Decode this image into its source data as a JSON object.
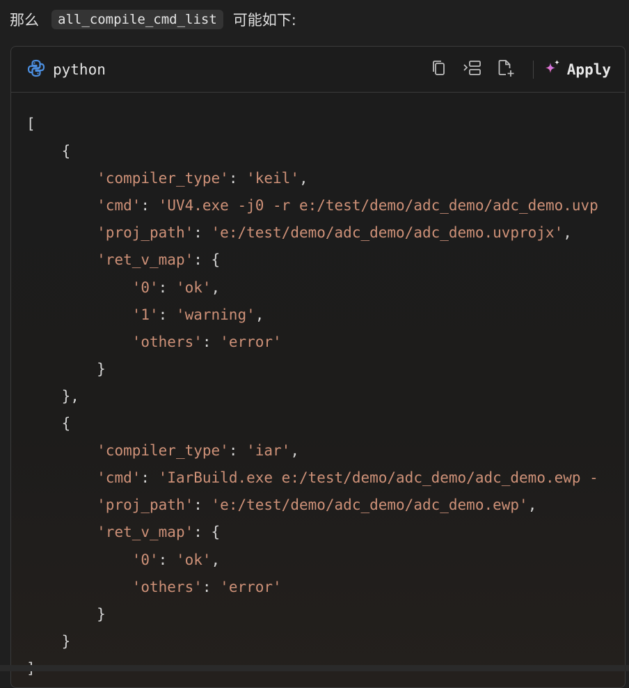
{
  "intro": {
    "prefix": "那么",
    "inline_code": "all_compile_cmd_list",
    "suffix": "可能如下:"
  },
  "code_block": {
    "language": "python",
    "apply_label": "Apply",
    "icons": {
      "language": "python-logo-icon",
      "copy": "copy-icon",
      "insert": "insert-at-cursor-icon",
      "new_file": "new-file-icon",
      "apply": "sparkle-icon"
    },
    "lines": [
      "[",
      "    {",
      "        'compiler_type': 'keil',",
      "        'cmd': 'UV4.exe -j0 -r e:/test/demo/adc_demo/adc_demo.uvp",
      "        'proj_path': 'e:/test/demo/adc_demo/adc_demo.uvprojx',",
      "        'ret_v_map': {",
      "            '0': 'ok',",
      "            '1': 'warning',",
      "            'others': 'error'",
      "        }",
      "    },",
      "    {",
      "        'compiler_type': 'iar',",
      "        'cmd': 'IarBuild.exe e:/test/demo/adc_demo/adc_demo.ewp -",
      "        'proj_path': 'e:/test/demo/adc_demo/adc_demo.ewp',",
      "        'ret_v_map': {",
      "            '0': 'ok',",
      "            'others': 'error'",
      "        }",
      "    }",
      "]"
    ]
  },
  "colors": {
    "string": "#ce9178",
    "punctuation": "#d4d4d4",
    "background": "#1f1f1f"
  }
}
